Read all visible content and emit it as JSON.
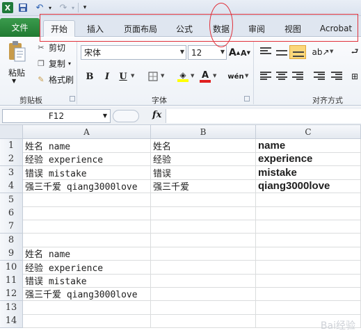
{
  "qat": {
    "logo_letter": "X",
    "icons": [
      "excel-logo-icon",
      "save-icon",
      "undo-icon",
      "redo-icon",
      "customize-qat-icon"
    ]
  },
  "tabs": {
    "file": "文件",
    "items": [
      "开始",
      "插入",
      "页面布局",
      "公式",
      "数据",
      "审阅",
      "视图",
      "Acrobat"
    ]
  },
  "ribbon": {
    "clipboard": {
      "paste": "粘贴",
      "cut": "剪切",
      "copy": "复制",
      "format_painter": "格式刷",
      "group_label": "剪贴板"
    },
    "font": {
      "font_name": "宋体",
      "font_size": "12",
      "bold": "B",
      "italic": "I",
      "underline": "U",
      "font_color_letter": "A",
      "phonetic": "wén",
      "grow_letter": "A",
      "shrink_letter": "A",
      "group_label": "字体",
      "fill_color": "#ffff00",
      "font_color": "#e02020"
    },
    "alignment": {
      "group_label": "对齐方式"
    }
  },
  "formula_bar": {
    "name_box": "F12",
    "fx_label": "fx",
    "formula": ""
  },
  "sheet": {
    "columns": [
      "A",
      "B",
      "C"
    ],
    "rows": [
      {
        "n": "1",
        "a": "姓名 name",
        "b": "姓名",
        "c": "name"
      },
      {
        "n": "2",
        "a": "经验 experience",
        "b": "经验",
        "c": "experience"
      },
      {
        "n": "3",
        "a": "错误 mistake",
        "b": "错误",
        "c": "mistake"
      },
      {
        "n": "4",
        "a": "强三千爱 qiang3000love",
        "b": "强三千爱",
        "c": "qiang3000love"
      },
      {
        "n": "5",
        "a": "",
        "b": "",
        "c": ""
      },
      {
        "n": "6",
        "a": "",
        "b": "",
        "c": ""
      },
      {
        "n": "7",
        "a": "",
        "b": "",
        "c": ""
      },
      {
        "n": "8",
        "a": "",
        "b": "",
        "c": ""
      },
      {
        "n": "9",
        "a": "姓名 name",
        "b": "",
        "c": ""
      },
      {
        "n": "10",
        "a": "经验 experience",
        "b": "",
        "c": ""
      },
      {
        "n": "11",
        "a": "错误 mistake",
        "b": "",
        "c": ""
      },
      {
        "n": "12",
        "a": "强三千爱 qiang3000love",
        "b": "",
        "c": ""
      },
      {
        "n": "13",
        "a": "",
        "b": "",
        "c": ""
      },
      {
        "n": "14",
        "a": "",
        "b": "",
        "c": ""
      }
    ]
  },
  "watermark": "Bai经验"
}
